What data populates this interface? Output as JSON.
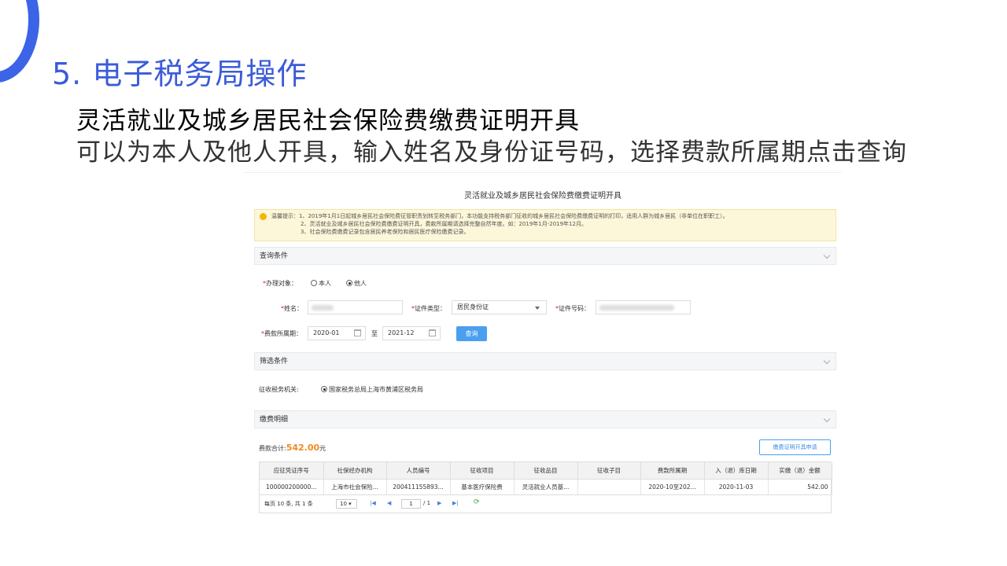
{
  "slide": {
    "title": "5. 电子税务局操作",
    "subtitle": "灵活就业及城乡居民社会保险费缴费证明开具",
    "description": "可以为本人及他人开具，输入姓名及身份证号码，选择费款所属期点击查询"
  },
  "page": {
    "title": "灵活就业及城乡居民社会保险费缴费证明开具",
    "notice": [
      "温馨提示：1、2019年1月1日起城乡居民社会保险费征管职责划转至税务部门，本功能支持税务部门征收的城乡居民社会保险费缴费证明的打印，适用人群为城乡居民（非单位在职职工）。",
      "2、灵活就业及城乡居民社会保险费缴费证明开具，费款所属期请选择完整自然年度。如：2019年1月-2019年12月。",
      "3、社会保险费缴费记录包含居民养老保险和居民医疗保险缴费记录。"
    ]
  },
  "query": {
    "header": "查询条件",
    "target_label": "办理对象：",
    "option_self": "本人",
    "option_other": "他人",
    "selected": "他人",
    "name_label": "姓名：",
    "id_type_label": "证件类型：",
    "id_type_value": "居民身份证",
    "id_no_label": "证件号码：",
    "period_label": "费款所属期：",
    "period_start": "2020-01",
    "period_to": "至",
    "period_end": "2021-12",
    "query_button": "查询"
  },
  "filter": {
    "header": "筛选条件",
    "authority_label": "征收税务机关:",
    "authority_value": "国家税务总局上海市黄浦区税务局"
  },
  "detail": {
    "header": "缴费明细",
    "total_label": "费款合计:",
    "total_amount": "542.00",
    "total_unit": "元",
    "apply_button": "缴费证明开具申请",
    "columns": [
      "应征凭证序号",
      "社保经办机构",
      "人员编号",
      "征收项目",
      "征收品目",
      "征收子目",
      "费款所属期",
      "入（退）库日期",
      "实缴（退）金额"
    ],
    "rows": [
      [
        "100000200000...",
        "上海市社会保险...",
        "200411155893...",
        "基本医疗保险费",
        "灵活就业人员基...",
        "",
        "2020-10至202...",
        "2020-11-03",
        "542.00"
      ]
    ],
    "pager": {
      "summary": "每页 10 条, 共 1 条",
      "page_size": "10",
      "page": "1",
      "page_total": "/ 1"
    }
  },
  "colors": {
    "accent": "#3b5bd9",
    "primary_button": "#4a9ff0",
    "amount": "#f08a24",
    "notice_bg": "#fdf7d9"
  }
}
